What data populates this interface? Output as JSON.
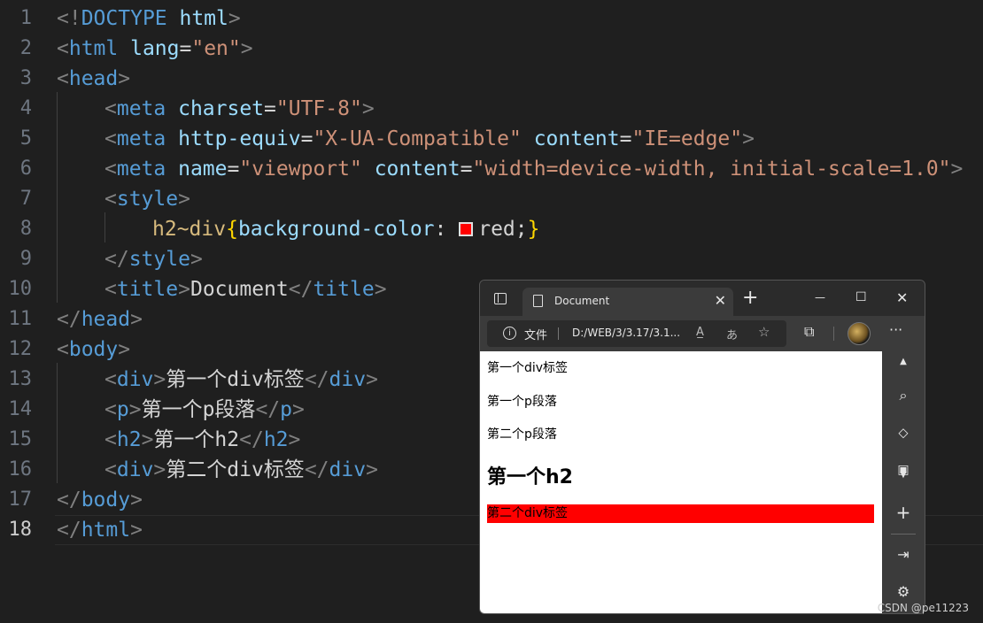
{
  "editor": {
    "active_line": "18",
    "lines": [
      {
        "num": "1"
      },
      {
        "num": "2"
      },
      {
        "num": "3"
      },
      {
        "num": "4"
      },
      {
        "num": "5"
      },
      {
        "num": "6"
      },
      {
        "num": "7"
      },
      {
        "num": "8"
      },
      {
        "num": "9"
      },
      {
        "num": "10"
      },
      {
        "num": "11"
      },
      {
        "num": "12"
      },
      {
        "num": "13"
      },
      {
        "num": "14"
      },
      {
        "num": "15"
      },
      {
        "num": "16"
      },
      {
        "num": "17"
      },
      {
        "num": "18"
      }
    ],
    "code": {
      "l1": [
        "<!",
        "DOCTYPE",
        " html",
        ">"
      ],
      "l2": [
        "<",
        "html",
        " lang",
        "=",
        "\"en\"",
        ">"
      ],
      "l3": [
        "<",
        "head",
        ">"
      ],
      "l4": [
        "<",
        "meta",
        " charset",
        "=",
        "\"UTF-8\"",
        ">"
      ],
      "l5": [
        "<",
        "meta",
        " http-equiv",
        "=",
        "\"X-UA-Compatible\"",
        " content",
        "=",
        "\"IE=edge\"",
        ">"
      ],
      "l6": [
        "<",
        "meta",
        " name",
        "=",
        "\"viewport\"",
        " content",
        "=",
        "\"width=device-width, initial-scale=1.0\"",
        ">"
      ],
      "l7": [
        "<",
        "style",
        ">"
      ],
      "l8": [
        "h2~div",
        "{",
        "background-color",
        ": ",
        "red;",
        "}"
      ],
      "l9": [
        "</",
        "style",
        ">"
      ],
      "l10": [
        "<",
        "title",
        ">",
        "Document",
        "</",
        "title",
        ">"
      ],
      "l11": [
        "</",
        "head",
        ">"
      ],
      "l12": [
        "<",
        "body",
        ">"
      ],
      "l13": [
        "<",
        "div",
        ">",
        "第一个div标签",
        "</",
        "div",
        ">"
      ],
      "l14": [
        "<",
        "p",
        ">",
        "第一个p段落",
        "</",
        "p",
        ">"
      ],
      "l15": [
        "<",
        "h2",
        ">",
        "第一个h2",
        "</",
        "h2",
        ">"
      ],
      "l16": [
        "<",
        "div",
        ">",
        "第二个div标签",
        "</",
        "div",
        ">"
      ],
      "l17": [
        "</",
        "body",
        ">"
      ],
      "l18": [
        "</",
        "html",
        ">"
      ]
    },
    "swatch_color": "#ff0000"
  },
  "browser": {
    "tab_title": "Document",
    "tab_close": "✕",
    "new_tab": "+",
    "minimize": "—",
    "maximize": "☐",
    "close": "✕",
    "address_label": "文件",
    "address_url": "D:/WEB/3/3.17/3.1...",
    "more": "···",
    "page": {
      "div1": "第一个div标签",
      "p1": "第一个p段落",
      "p2": "第二个p段落",
      "h2": "第一个h2",
      "div2": "第二个div标签"
    },
    "div2_bg": "#ff0000"
  },
  "watermark": "CSDN @pe11223"
}
